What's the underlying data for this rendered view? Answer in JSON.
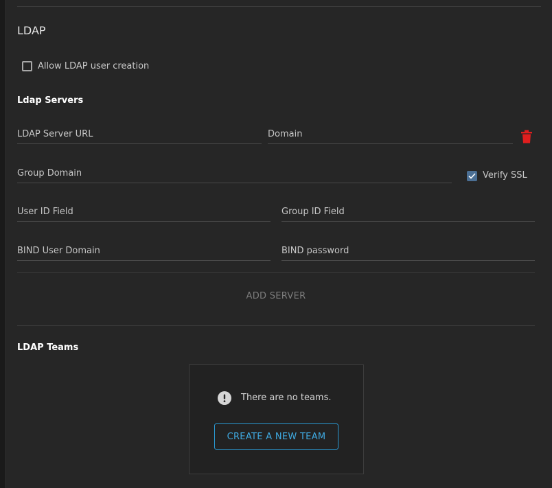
{
  "ldap": {
    "title": "LDAP",
    "allow_user_creation_label": "Allow LDAP user creation",
    "allow_user_creation_checked": false
  },
  "servers": {
    "title": "Ldap Servers",
    "fields": {
      "server_url": "LDAP Server URL",
      "domain": "Domain",
      "group_domain": "Group Domain",
      "verify_ssl": "Verify SSL",
      "user_id_field": "User ID Field",
      "group_id_field": "Group ID Field",
      "bind_user_domain": "BIND User Domain",
      "bind_password": "BIND password"
    },
    "verify_ssl_checked": true,
    "delete_icon": "trash-icon",
    "delete_color": "#e01e1e",
    "add_server_label": "ADD SERVER"
  },
  "teams": {
    "title": "LDAP Teams",
    "empty_message": "There are no teams.",
    "empty_icon": "exclamation-circle-icon",
    "create_button_label": "CREATE A NEW TEAM",
    "accent_color": "#2a9bd6"
  }
}
